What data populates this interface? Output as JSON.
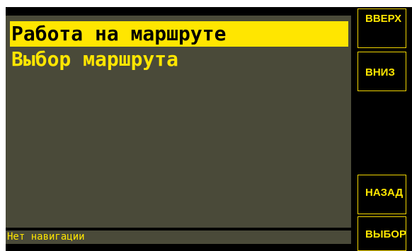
{
  "menu": {
    "items": [
      {
        "label": "Работа на маршруте",
        "selected": true
      },
      {
        "label": "Выбор маршрута",
        "selected": false
      }
    ]
  },
  "status": {
    "text": "Нет навигации"
  },
  "buttons": {
    "up": "ВВЕРХ",
    "down": "ВНИЗ",
    "back": "НАЗАД",
    "select": "ВЫБОР"
  },
  "colors": {
    "screen_bg": "#4a4a39",
    "accent_yellow": "#ffe600",
    "device_bg": "#000000"
  }
}
